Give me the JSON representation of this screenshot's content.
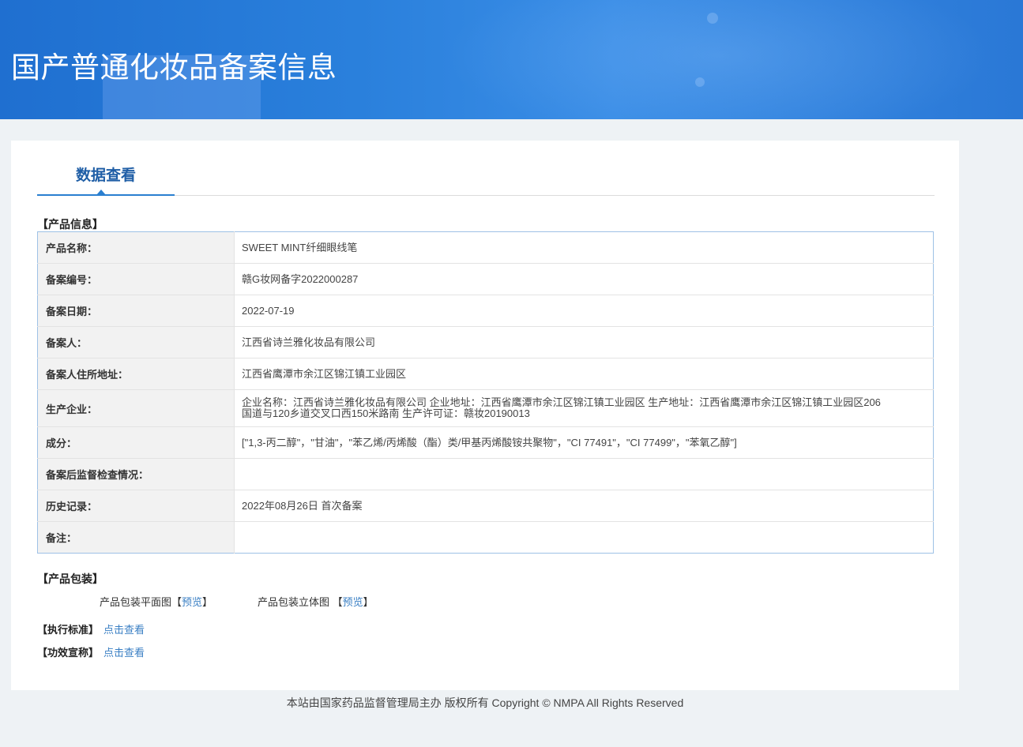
{
  "banner": {
    "title": "国产普通化妆品备案信息"
  },
  "tabs": [
    {
      "label": "数据查看"
    }
  ],
  "product_info": {
    "section_title": "【产品信息】",
    "rows": [
      {
        "label": "产品名称：",
        "value": "SWEET MINT纤细眼线笔"
      },
      {
        "label": "备案编号：",
        "value": "赣G妆网备字2022000287"
      },
      {
        "label": "备案日期：",
        "value": "2022-07-19"
      },
      {
        "label": "备案人：",
        "value": "江西省诗兰雅化妆品有限公司"
      },
      {
        "label": "备案人住所地址：",
        "value": "江西省鹰潭市余江区锦江镇工业园区"
      },
      {
        "label": "生产企业：",
        "value": "企业名称：江西省诗兰雅化妆品有限公司 企业地址：江西省鹰潭市余江区锦江镇工业园区 生产地址：江西省鹰潭市余江区锦江镇工业园区206国道与120乡道交叉口西150米路南 生产许可证：赣妆20190013"
      },
      {
        "label": "成分：",
        "value": "[\"1,3-丙二醇\"，\"甘油\"，\"苯乙烯/丙烯酸（酯）类/甲基丙烯酸铵共聚物\"，\"CI 77491\"，\"CI 77499\"，\"苯氧乙醇\"]"
      },
      {
        "label": "备案后监督检查情况：",
        "value": ""
      },
      {
        "label": "历史记录：",
        "value": "2022年08月26日 首次备案"
      },
      {
        "label": "备注：",
        "value": ""
      }
    ]
  },
  "packaging": {
    "section_title": "【产品包装】",
    "flat_label": "产品包装平面图",
    "flat_link": "预览",
    "solid_label": "产品包装立体图",
    "solid_link": "预览",
    "bracket_open": "【",
    "bracket_close": "】"
  },
  "standard": {
    "title": "【执行标准】",
    "link": "点击查看"
  },
  "efficacy": {
    "title": "【功效宣称】",
    "link": "点击查看"
  },
  "footer": {
    "text": "本站由国家药品监督管理局主办 版权所有 Copyright © NMPA All Rights Reserved"
  }
}
